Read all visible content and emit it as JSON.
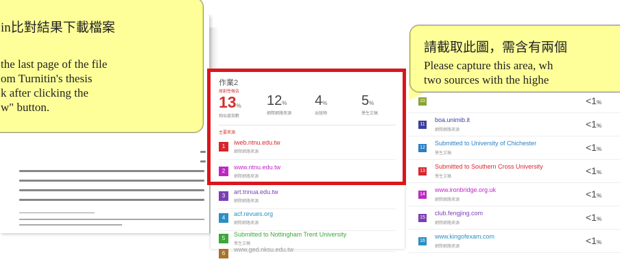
{
  "callout_left": {
    "line1": "in比對結果下載檔案",
    "line2": " the last page of the file",
    "line3": "om Turnitin's thesis",
    "line4": "k after clicking the",
    "line5": "w\" button."
  },
  "callout_right": {
    "line1": "請截取此圖，需含有兩個",
    "line2": "Please capture this area, wh",
    "line3": "two sources with the highe"
  },
  "panel": {
    "title": "作業2",
    "subtitle": "原創性報告",
    "stats": [
      {
        "value": "13",
        "pct": "%",
        "caption": "相似度指數"
      },
      {
        "value": "12",
        "pct": "%",
        "caption": "網際網路來源"
      },
      {
        "value": "4",
        "pct": "%",
        "caption": "出版物"
      },
      {
        "value": "5",
        "pct": "%",
        "caption": "學生文稿"
      }
    ],
    "section_label": "主要來源",
    "sources": [
      {
        "num": "1",
        "name": "iweb.ntnu.edu.tw",
        "type": "網際網路來源",
        "color": "#d7262b",
        "text_color": "#d7262b"
      },
      {
        "num": "2",
        "name": "www.ntnu.edu.tw",
        "type": "網際網路來源",
        "color": "#c026c6",
        "text_color": "#c026c6"
      },
      {
        "num": "3",
        "name": "art.tnnua.edu.tw",
        "type": "網際網路來源",
        "color": "#7b3fb3",
        "text_color": "#7b3fb3"
      },
      {
        "num": "4",
        "name": "acf.revues.org",
        "type": "網際網路來源",
        "color": "#2a8fc4",
        "text_color": "#2a8fc4"
      },
      {
        "num": "5",
        "name": "Submitted to Nottingham Trent University",
        "type": "學生文稿",
        "color": "#3aa83a",
        "text_color": "#3aa83a"
      },
      {
        "num": "6",
        "name": "www.ged.nksu.edu.tw",
        "type": "",
        "color": "#a8742c",
        "text_color": "#999999"
      }
    ]
  },
  "right_list": [
    {
      "num": "10",
      "name": "",
      "type": "",
      "color": "#8aa334",
      "pct": "<1",
      "unit": "%"
    },
    {
      "num": "11",
      "name": "boa.unimib.it",
      "type": "網際網路來源",
      "color": "#3b3f9e",
      "text_color": "#3b3f9e",
      "pct": "<1",
      "unit": "%"
    },
    {
      "num": "12",
      "name": "Submitted to University of Chichester",
      "type": "學生文稿",
      "color": "#2a7fc4",
      "text_color": "#2a7fc4",
      "pct": "<1",
      "unit": "%"
    },
    {
      "num": "13",
      "name": "Submitted to Southern Cross University",
      "type": "學生文稿",
      "color": "#d7262b",
      "text_color": "#d7262b",
      "pct": "<1",
      "unit": "%"
    },
    {
      "num": "14",
      "name": "www.ironbridge.org.uk",
      "type": "網際網路來源",
      "color": "#c026c6",
      "text_color": "#c026c6",
      "pct": "<1",
      "unit": "%"
    },
    {
      "num": "15",
      "name": "club.fengjing.com",
      "type": "網際網路來源",
      "color": "#7b3fb3",
      "text_color": "#7b3fb3",
      "pct": "<1",
      "unit": "%"
    },
    {
      "num": "16",
      "name": "www.kingofexam.com",
      "type": "網際網路來源",
      "color": "#2a8fc4",
      "text_color": "#2a8fc4",
      "pct": "<1",
      "unit": "%"
    }
  ]
}
